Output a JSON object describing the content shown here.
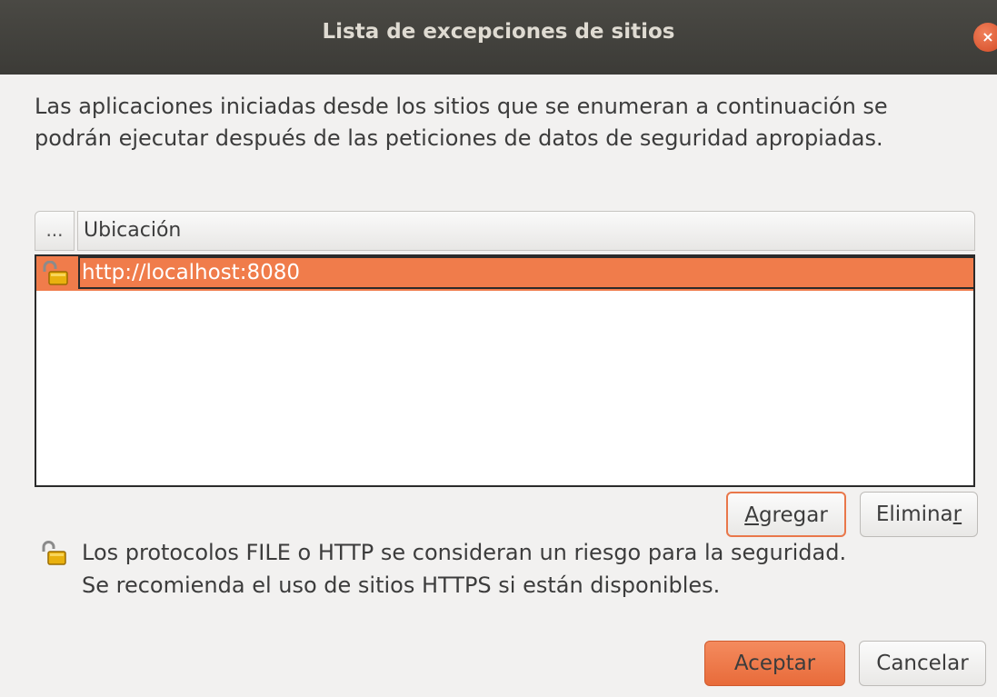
{
  "window": {
    "title": "Lista de excepciones de sitios",
    "close_glyph": "×"
  },
  "description": "Las aplicaciones iniciadas desde los sitios que se enumeran a continuación se podrán ejecutar después de las peticiones de datos de seguridad apropiadas.",
  "table": {
    "menu_column_label": "...",
    "location_column_label": "Ubicación",
    "rows": [
      {
        "icon": "open-lock-icon",
        "location": "http://localhost:8080",
        "selected": true
      }
    ]
  },
  "buttons": {
    "add_mnemonic": "A",
    "add_rest": "gregar",
    "remove_main": "Elimina",
    "remove_mnemonic": "r",
    "ok_label": "Aceptar",
    "cancel_label": "Cancelar"
  },
  "warning": {
    "icon": "open-lock-icon",
    "line1": "Los protocolos FILE o HTTP se consideran un riesgo para la seguridad.",
    "line2": "Se recomienda el uso de sitios HTTPS si están disponibles."
  },
  "colors": {
    "accent": "#f07c4b",
    "titlebar": "#3c3b37"
  }
}
